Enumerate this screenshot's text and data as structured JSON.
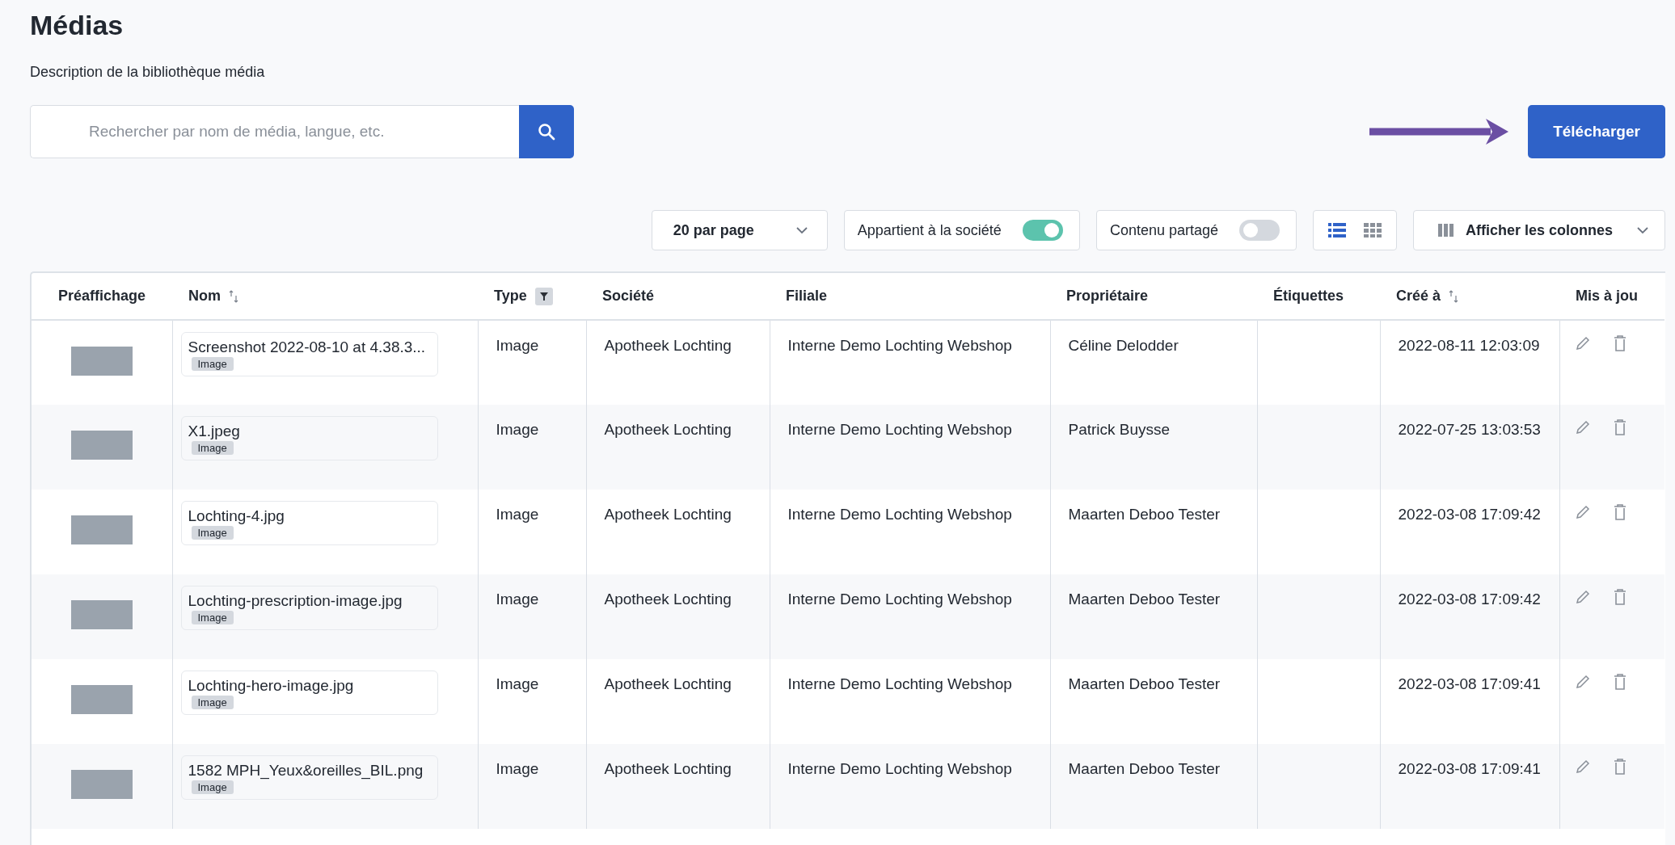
{
  "page": {
    "title": "Médias",
    "description": "Description de la bibliothèque média"
  },
  "search": {
    "placeholder": "Rechercher par nom de média, langue, etc."
  },
  "upload_button": "Télécharger",
  "toolbar": {
    "page_size": "20 par page",
    "toggles": [
      {
        "label": "Appartient à la société",
        "on": true
      },
      {
        "label": "Contenu partagé",
        "on": false
      }
    ],
    "view_modes": [
      {
        "kind": "list",
        "selected": true
      },
      {
        "kind": "grid",
        "selected": false
      }
    ],
    "columns_button": "Afficher les colonnes"
  },
  "table": {
    "columns": [
      {
        "label": "Préaffichage",
        "kind": "plain"
      },
      {
        "label": "Nom",
        "kind": "sort"
      },
      {
        "label": "Type",
        "kind": "filter"
      },
      {
        "label": "Société",
        "kind": "plain"
      },
      {
        "label": "Filiale",
        "kind": "plain"
      },
      {
        "label": "Propriétaire",
        "kind": "plain"
      },
      {
        "label": "Étiquettes",
        "kind": "plain"
      },
      {
        "label": "Créé à",
        "kind": "sort"
      },
      {
        "label": "Mis à jou",
        "kind": "plain"
      }
    ],
    "rows": [
      {
        "name": "Screenshot 2022-08-10 at 4.38.3...",
        "tag": "Image",
        "type": "Image",
        "company": "Apotheek Lochting",
        "branch": "Interne Demo Lochting Webshop",
        "owner": "Céline Delodder",
        "created": "2022-08-11 12:03:09"
      },
      {
        "name": "X1.jpeg",
        "tag": "Image",
        "type": "Image",
        "company": "Apotheek Lochting",
        "branch": "Interne Demo Lochting Webshop",
        "owner": "Patrick Buysse",
        "created": "2022-07-25 13:03:53"
      },
      {
        "name": "Lochting-4.jpg",
        "tag": "Image",
        "type": "Image",
        "company": "Apotheek Lochting",
        "branch": "Interne Demo Lochting Webshop",
        "owner": "Maarten Deboo Tester",
        "created": "2022-03-08 17:09:42"
      },
      {
        "name": "Lochting-prescription-image.jpg",
        "tag": "Image",
        "type": "Image",
        "company": "Apotheek Lochting",
        "branch": "Interne Demo Lochting Webshop",
        "owner": "Maarten Deboo Tester",
        "created": "2022-03-08 17:09:42"
      },
      {
        "name": "Lochting-hero-image.jpg",
        "tag": "Image",
        "type": "Image",
        "company": "Apotheek Lochting",
        "branch": "Interne Demo Lochting Webshop",
        "owner": "Maarten Deboo Tester",
        "created": "2022-03-08 17:09:41"
      },
      {
        "name": "1582 MPH_Yeux&oreilles_BIL.png",
        "tag": "Image",
        "type": "Image",
        "company": "Apotheek Lochting",
        "branch": "Interne Demo Lochting Webshop",
        "owner": "Maarten Deboo Tester",
        "created": "2022-03-08 17:09:41"
      }
    ]
  }
}
